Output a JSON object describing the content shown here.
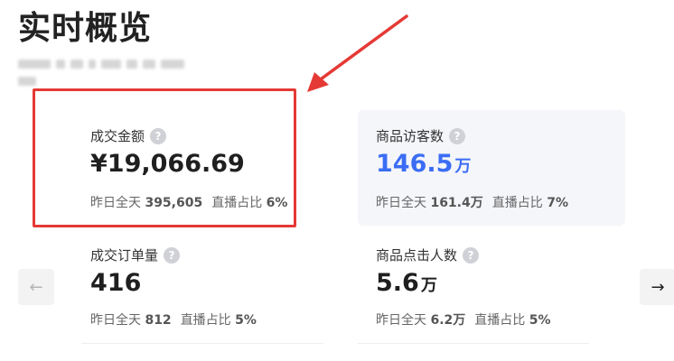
{
  "page": {
    "title": "实时概览"
  },
  "cards": [
    {
      "label": "成交金额",
      "value": "¥19,066.69",
      "unit": "",
      "meta_yesterday_label": "昨日全天",
      "meta_yesterday_value": "395,605",
      "meta_live_label": "直播占比",
      "meta_live_value": "6%"
    },
    {
      "label": "商品访客数",
      "value": "146.5",
      "unit": "万",
      "meta_yesterday_label": "昨日全天",
      "meta_yesterday_value": "161.4万",
      "meta_live_label": "直播占比",
      "meta_live_value": "7%"
    },
    {
      "label": "成交订单量",
      "value": "416",
      "unit": "",
      "meta_yesterday_label": "昨日全天",
      "meta_yesterday_value": "812",
      "meta_live_label": "直播占比",
      "meta_live_value": "5%"
    },
    {
      "label": "商品点击人数",
      "value": "5.6",
      "unit": "万",
      "meta_yesterday_label": "昨日全天",
      "meta_yesterday_value": "6.2万",
      "meta_live_label": "直播占比",
      "meta_live_value": "5%"
    }
  ],
  "icons": {
    "help": "question-circle-icon",
    "prev": "arrow-left-icon",
    "next": "arrow-right-icon"
  },
  "colors": {
    "accent_blue": "#3b6df4",
    "annotation_red": "#e53935",
    "highlight_bg": "#f5f6fa"
  },
  "glyphs": {
    "help": "?",
    "prev": "←",
    "next": "→"
  }
}
